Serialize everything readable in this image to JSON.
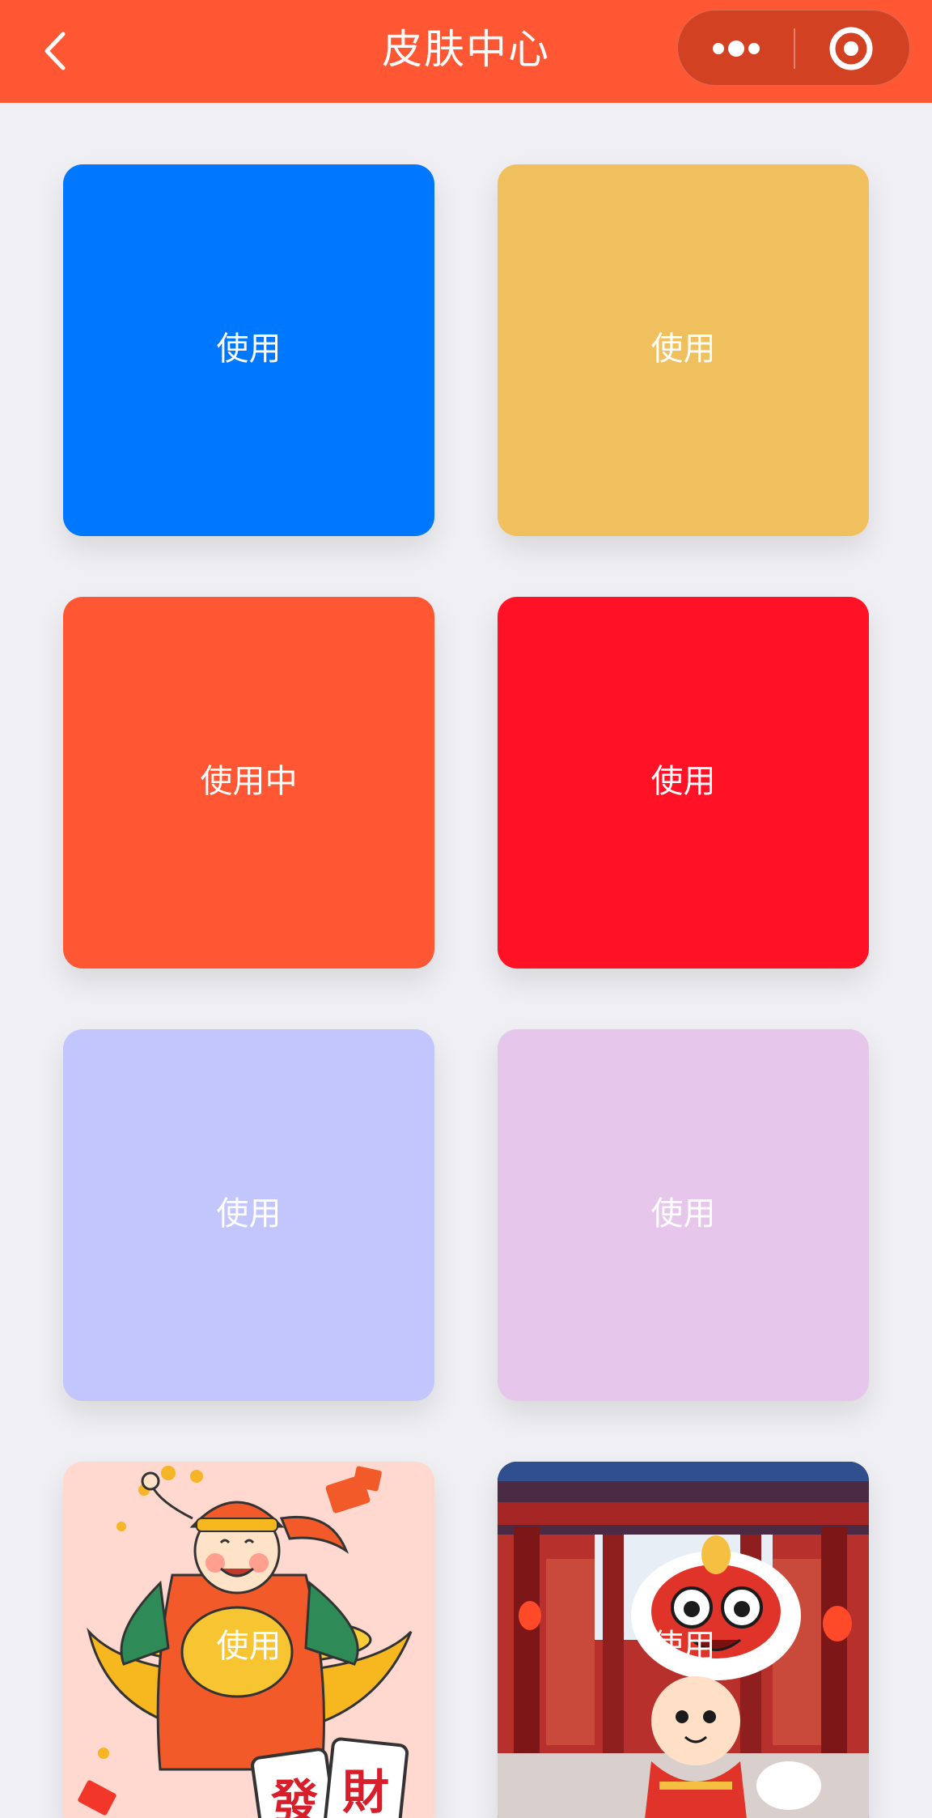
{
  "navbar": {
    "title": "皮肤中心",
    "background": "#ff5733",
    "back_icon": "chevron-left-icon",
    "more_icon": "more-dots-icon",
    "close_icon": "target-circle-icon"
  },
  "skins": [
    {
      "label": "使用",
      "color": "#0077ff",
      "active": false
    },
    {
      "label": "使用",
      "color": "#f0c05e",
      "active": false
    },
    {
      "label": "使用中",
      "color": "#ff5733",
      "active": true
    },
    {
      "label": "使用",
      "color": "#ff1226",
      "active": false
    },
    {
      "label": "使用",
      "color": "#c3c6fd",
      "active": false
    },
    {
      "label": "使用",
      "color": "#e6c6eb",
      "active": false
    },
    {
      "label": "使用",
      "color": "#ffd9cf",
      "active": false,
      "image": "god-of-wealth-illustration",
      "image_text": [
        "發",
        "財"
      ]
    },
    {
      "label": "使用",
      "color": "#b8302b",
      "active": false,
      "image": "lion-dance-temple-illustration"
    }
  ]
}
